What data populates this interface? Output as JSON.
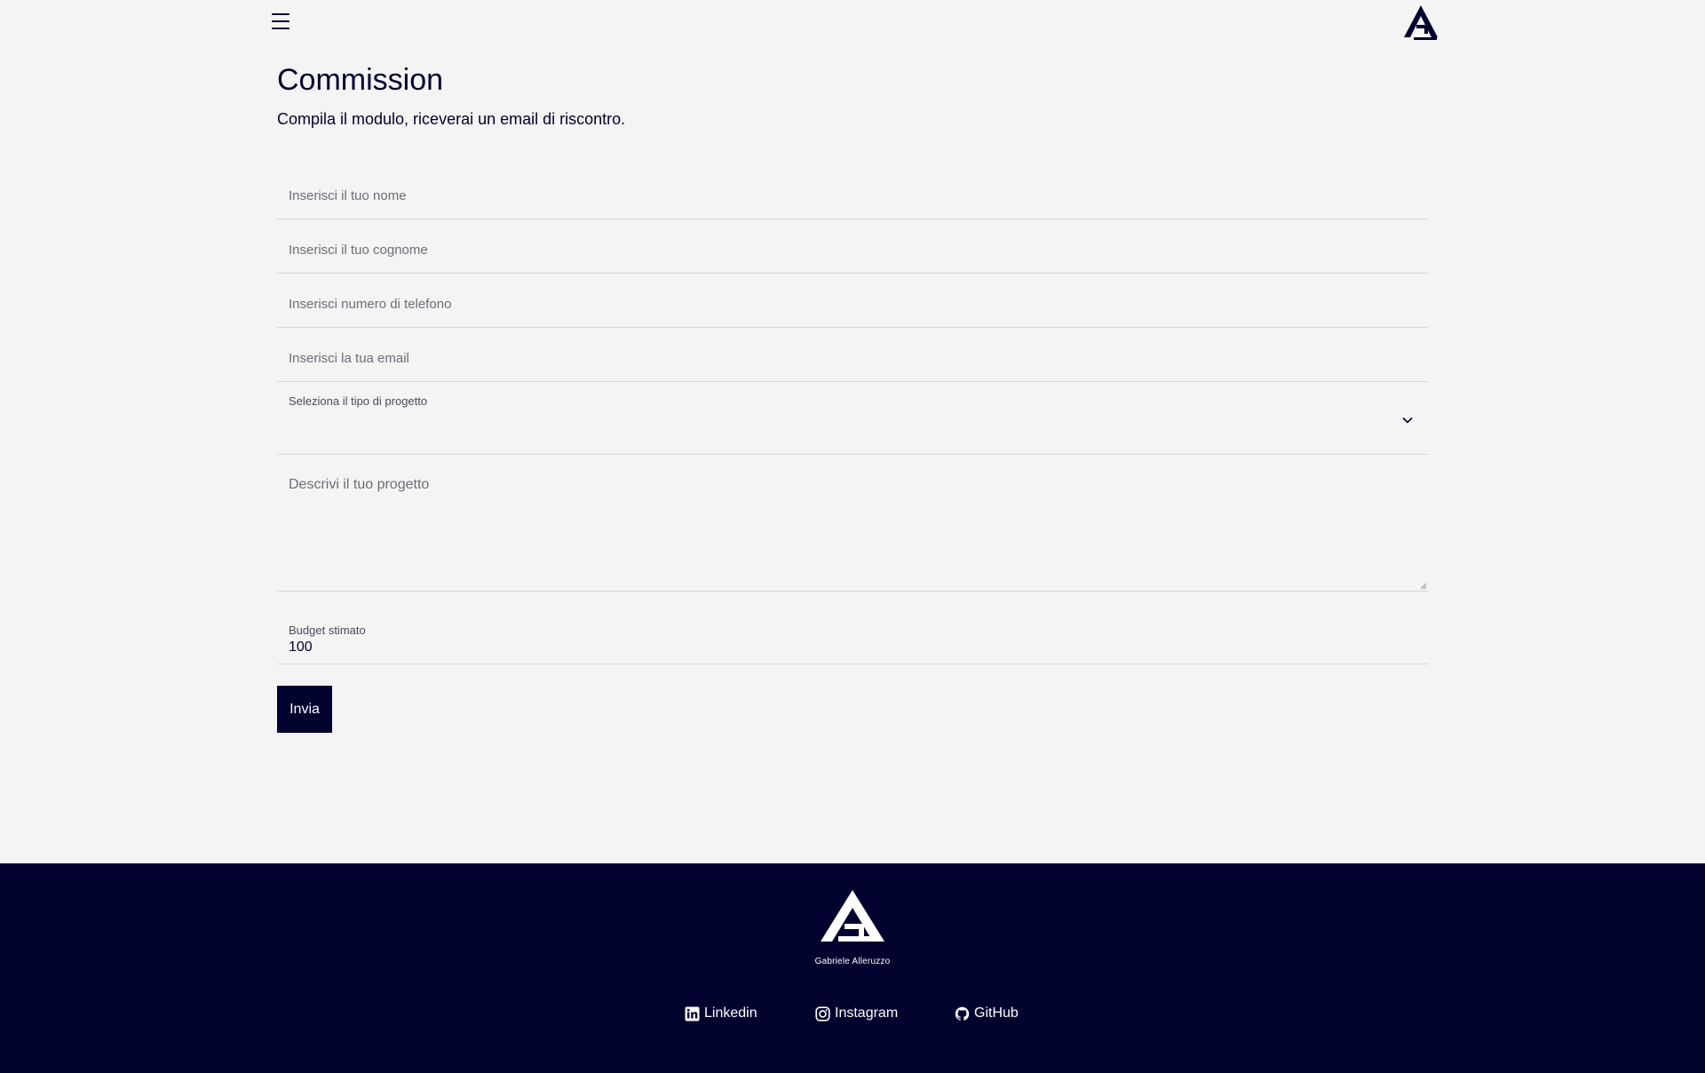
{
  "header": {
    "menu_icon": "hamburger-menu-icon",
    "logo_icon": "ga-monogram-logo"
  },
  "form": {
    "title": "Commission",
    "subtitle": "Compila il modulo, riceverai un email di riscontro.",
    "fields": {
      "nome": {
        "placeholder": "Inserisci il tuo nome",
        "value": ""
      },
      "cognome": {
        "placeholder": "Inserisci il tuo cognome",
        "value": ""
      },
      "telefono": {
        "placeholder": "Inserisci numero di telefono",
        "value": ""
      },
      "email": {
        "placeholder": "Inserisci la tua email",
        "value": ""
      },
      "tipo_progetto": {
        "label": "Seleziona il tipo di progetto",
        "selected": ""
      },
      "descrizione": {
        "placeholder": "Descrivi il tuo progetto",
        "value": ""
      },
      "budget": {
        "label": "Budget stimato",
        "value": "100"
      }
    },
    "submit_label": "Invia"
  },
  "footer": {
    "logo_icon": "ga-monogram-logo",
    "brand_name": "Gabriele Alleruzzo",
    "social": [
      {
        "label": "Linkedin",
        "icon": "linkedin-icon"
      },
      {
        "label": "Instagram",
        "icon": "instagram-icon"
      },
      {
        "label": "GitHub",
        "icon": "github-icon"
      }
    ]
  },
  "colors": {
    "primary": "#02022f",
    "background": "#f4f4f4",
    "divider": "#d6d6dc"
  }
}
